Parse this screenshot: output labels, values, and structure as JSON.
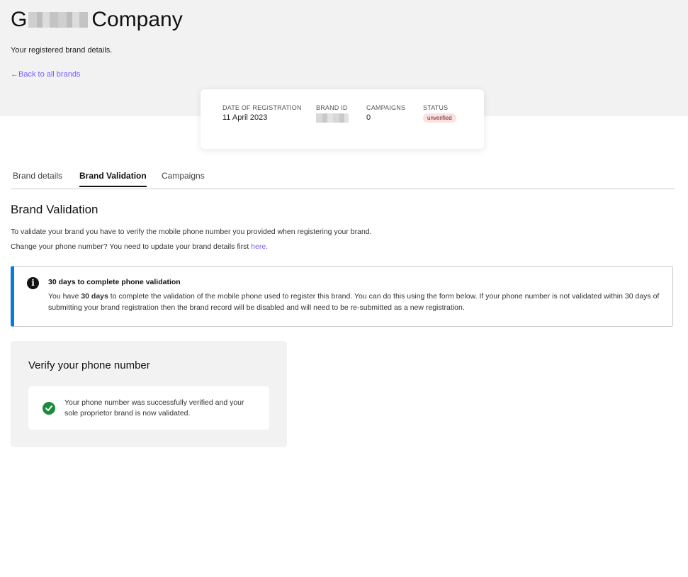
{
  "header": {
    "title_first": "G",
    "title_rest": "Company",
    "subtitle": "Your registered brand details.",
    "back_link": "←Back to all brands"
  },
  "summary": {
    "date_label": "DATE OF REGISTRATION",
    "date_value": "11 April 2023",
    "brand_id_label": "BRAND ID",
    "campaigns_label": "CAMPAIGNS",
    "campaigns_value": "0",
    "status_label": "STATUS",
    "status_value": "unverified",
    "status_color": "#fde0e0"
  },
  "tabs": [
    {
      "label": "Brand details",
      "active": false
    },
    {
      "label": "Brand Validation",
      "active": true
    },
    {
      "label": "Campaigns",
      "active": false
    }
  ],
  "section": {
    "heading": "Brand Validation",
    "paragraph1": "To validate your brand you have to verify the mobile phone number you provided when registering your brand.",
    "paragraph2_prefix": "Change your phone number? You need to update your brand details first ",
    "paragraph2_link": "here."
  },
  "notice": {
    "icon": "info-icon",
    "title": "30 days to complete phone validation",
    "body_before": "You have ",
    "body_bold": "30 days",
    "body_after": " to complete the validation of the mobile phone used to register this brand. You can do this using the form below. If your phone number is not validated within 30 days of submitting your brand registration then the brand record will be disabled and will need to be re-submitted as a new registration.",
    "accent_color": "#0a7ad6"
  },
  "verify": {
    "heading": "Verify your phone number",
    "icon": "check-circle-icon",
    "message": "Your phone number was successfully verified and your sole proprietor brand is now validated.",
    "success_color": "#1e8a3e"
  },
  "colors": {
    "link": "#7b5cff",
    "hero_bg": "#f2f2f2"
  }
}
